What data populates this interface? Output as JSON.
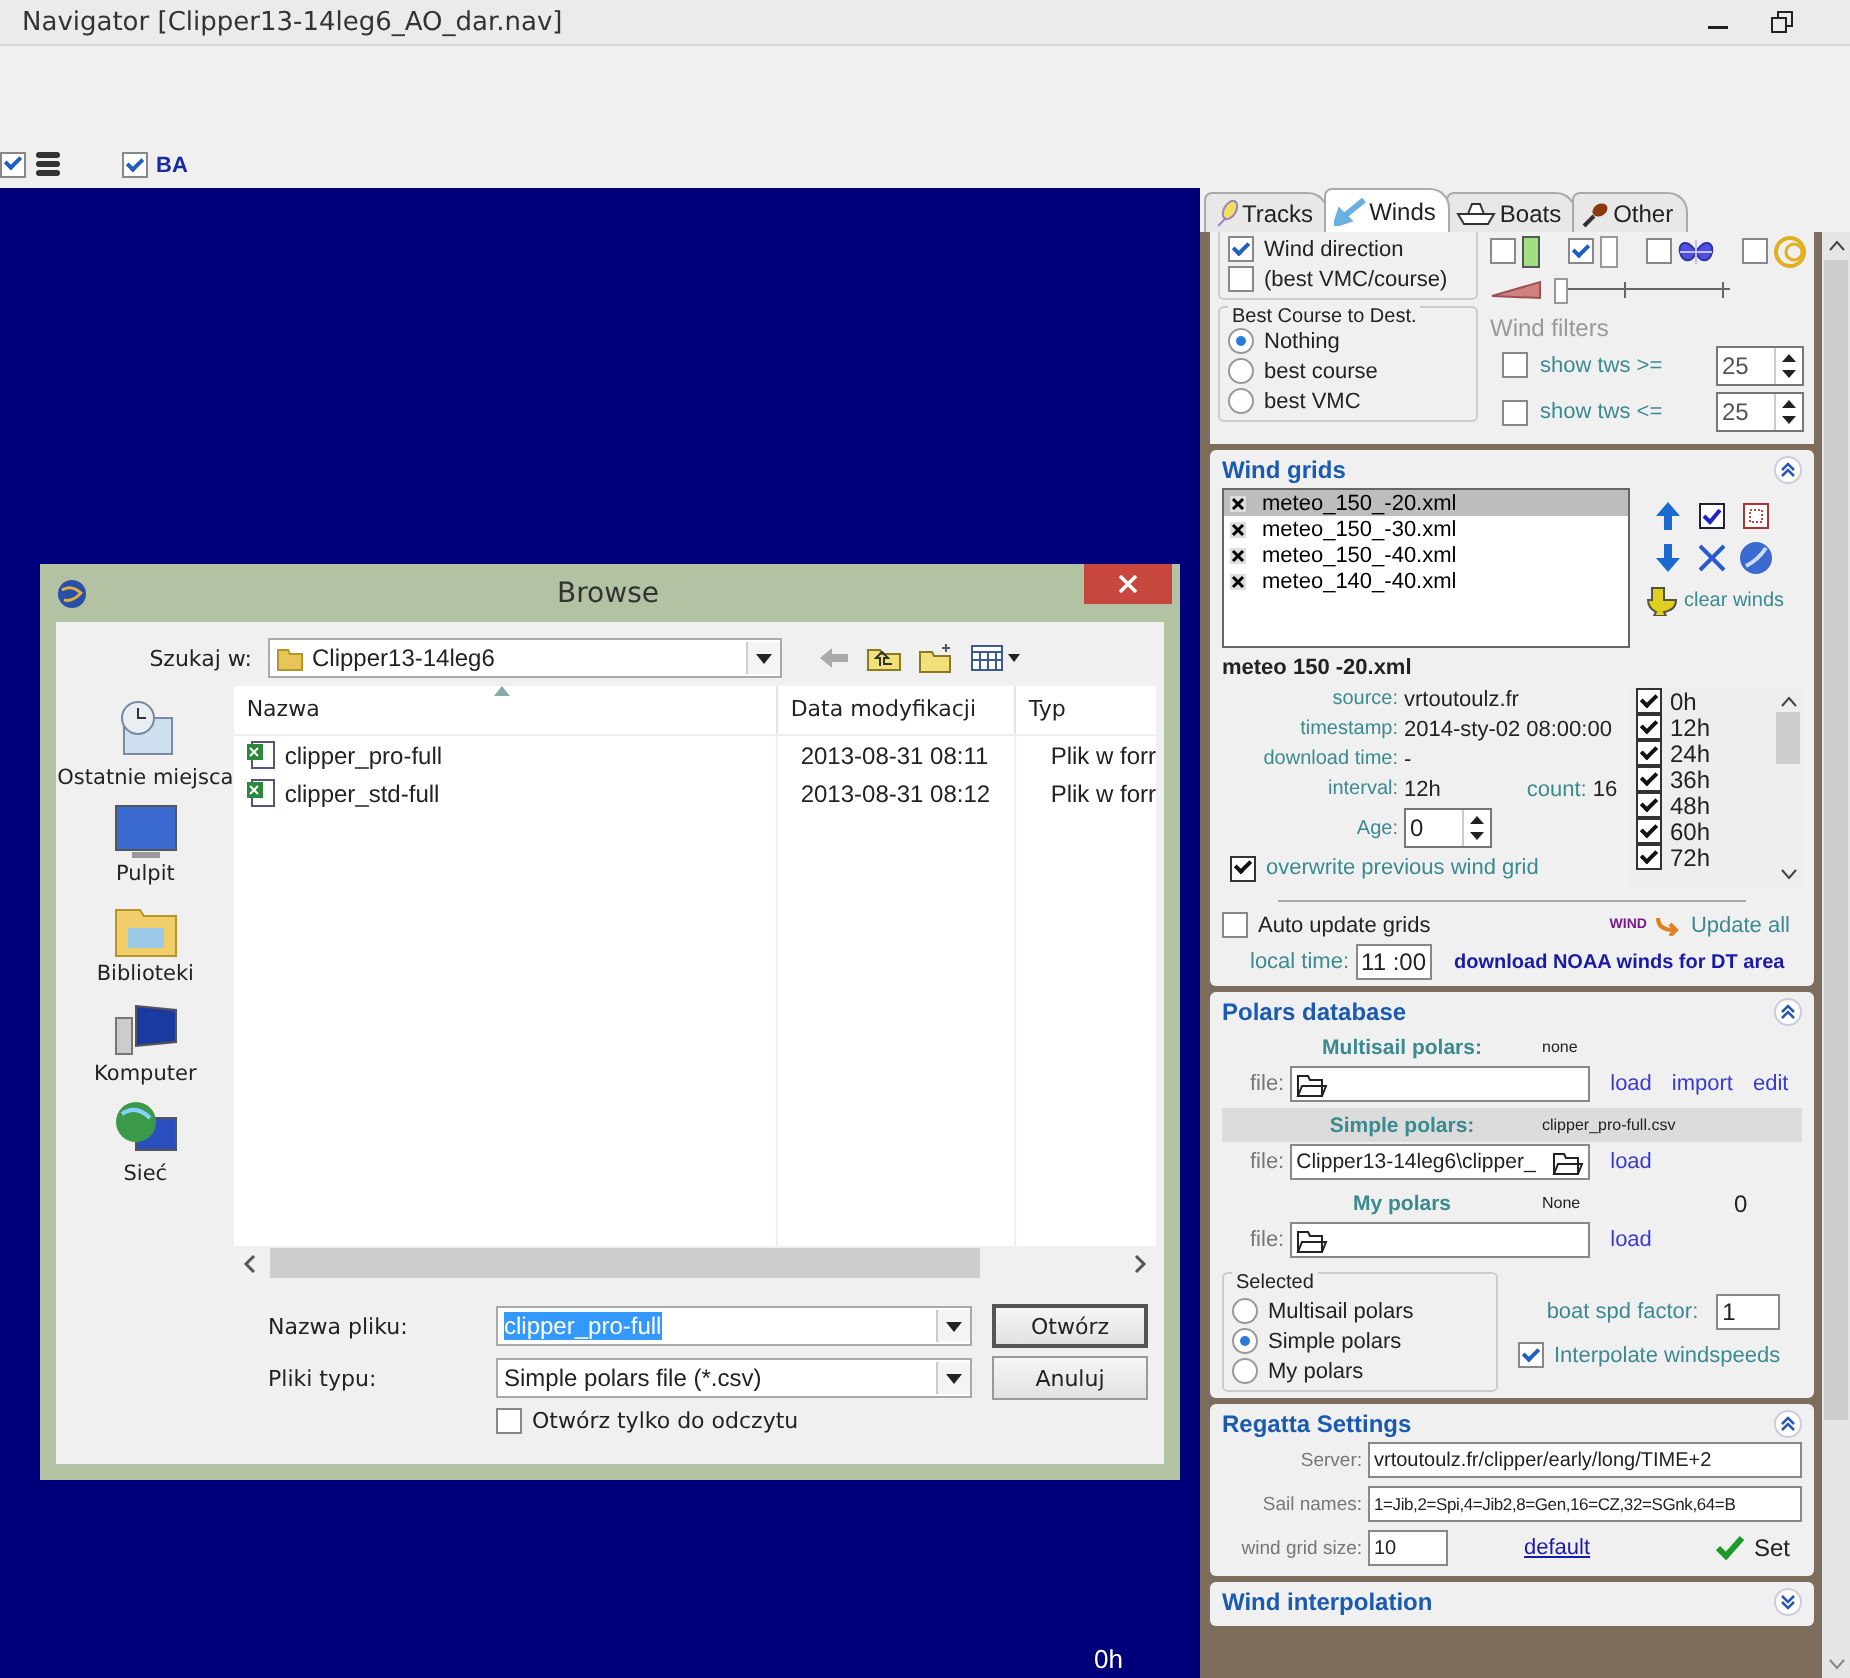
{
  "window": {
    "title": "Navigator [Clipper13-14leg6_AO_dar.nav]"
  },
  "toolbar": {
    "items": [
      {
        "kind": "stack",
        "checked": true
      },
      {
        "kind": "label",
        "label": "BA",
        "checked": true
      }
    ]
  },
  "map": {
    "time_label": "0h"
  },
  "dialog": {
    "title": "Browse",
    "look_in_label": "Szukaj w:",
    "look_in_value": "Clipper13-14leg6",
    "places": [
      {
        "kind": "recent",
        "label": "Ostatnie miejsca"
      },
      {
        "kind": "desktop",
        "label": "Pulpit"
      },
      {
        "kind": "libraries",
        "label": "Biblioteki"
      },
      {
        "kind": "computer",
        "label": "Komputer"
      },
      {
        "kind": "network",
        "label": "Sieć"
      }
    ],
    "columns": [
      "Nazwa",
      "Data modyfikacji",
      "Typ"
    ],
    "files": [
      {
        "name": "clipper_pro-full",
        "modified": "2013-08-31 08:11",
        "type": "Plik w forr"
      },
      {
        "name": "clipper_std-full",
        "modified": "2013-08-31 08:12",
        "type": "Plik w forr"
      }
    ],
    "filename_label": "Nazwa pliku:",
    "filename_value": "clipper_pro-full",
    "filetype_label": "Pliki typu:",
    "filetype_value": "Simple polars file (*.csv)",
    "readonly": {
      "label": "Otwórz tylko do odczytu",
      "checked": false
    },
    "buttons": [
      "Otwórz",
      "Anuluj"
    ]
  },
  "panel": {
    "tabs": [
      {
        "label": "Tracks",
        "selected": false
      },
      {
        "label": "Winds",
        "selected": true
      },
      {
        "label": "Boats",
        "selected": false
      },
      {
        "label": "Other",
        "selected": false
      }
    ],
    "wind_display": {
      "options": [
        {
          "label": "Wind direction",
          "checked": true
        },
        {
          "label": "(best VMC/course)",
          "checked": false
        }
      ],
      "toggles": [
        {
          "kind": "green-bar",
          "checked": false
        },
        {
          "kind": "plain-bar",
          "checked": true
        },
        {
          "kind": "butterfly",
          "checked": false
        },
        {
          "kind": "rings",
          "checked": false
        }
      ],
      "slider": {
        "level": 0
      }
    },
    "best_course": {
      "title": "Best Course to Dest.",
      "options": [
        {
          "label": "Nothing",
          "selected": true
        },
        {
          "label": "best course",
          "selected": false
        },
        {
          "label": "best VMC",
          "selected": false
        }
      ]
    },
    "wind_filters": {
      "title": "Wind filters",
      "rows": [
        {
          "label": "show tws >=",
          "checked": false,
          "value": "25"
        },
        {
          "label": "show tws <=",
          "checked": false,
          "value": "25"
        }
      ]
    },
    "wind_grids": {
      "title": "Wind grids",
      "files": [
        {
          "name": "meteo_150_-20.xml",
          "selected": true
        },
        {
          "name": "meteo_150_-30.xml",
          "selected": false
        },
        {
          "name": "meteo_150_-40.xml",
          "selected": false
        },
        {
          "name": "meteo_140_-40.xml",
          "selected": false
        }
      ],
      "clear_label": "clear winds",
      "current": "meteo  150  -20.xml",
      "details": [
        {
          "label": "source:",
          "value": "vrtoutoulz.fr"
        },
        {
          "label": "timestamp:",
          "value": "2014-sty-02 08:00:00"
        },
        {
          "label": "download time:",
          "value": "-"
        }
      ],
      "interval_label": "interval:",
      "interval": "12h",
      "count_label": "count:",
      "count": "16",
      "age_label": "Age:",
      "age": "0",
      "overwrite": {
        "label": "overwrite previous wind grid",
        "checked": true
      },
      "hours": [
        {
          "label": "0h",
          "checked": true
        },
        {
          "label": "12h",
          "checked": true
        },
        {
          "label": "24h",
          "checked": true
        },
        {
          "label": "36h",
          "checked": true
        },
        {
          "label": "48h",
          "checked": true
        },
        {
          "label": "60h",
          "checked": true
        },
        {
          "label": "72h",
          "checked": true
        }
      ],
      "auto_update": {
        "label": "Auto update grids",
        "checked": false
      },
      "wind_badge": "WIND",
      "update_all": "Update all",
      "local_time_label": "local time:",
      "local_time": "11 :00",
      "download_link": "download NOAA winds for DT area"
    },
    "polars": {
      "title": "Polars database",
      "sources": [
        {
          "title": "Multisail polars:",
          "status": "none",
          "file_label": "file:",
          "links": [
            "load",
            "import",
            "edit"
          ],
          "highlighted": false
        },
        {
          "title": "Simple polars:",
          "status": "clipper_pro-full.csv",
          "file_label": "file:",
          "value": "Clipper13-14leg6\\clipper_",
          "links": [
            "load"
          ],
          "highlighted": true
        },
        {
          "title": "My polars",
          "status": "None",
          "file_label": "file:",
          "links": [
            "load"
          ],
          "highlighted": false,
          "count": "0"
        }
      ],
      "selected_title": "Selected",
      "selected_options": [
        {
          "label": "Multisail polars",
          "selected": false
        },
        {
          "label": "Simple polars",
          "selected": true
        },
        {
          "label": "My polars",
          "selected": false
        }
      ],
      "factor_label": "boat spd factor:",
      "factor": "1",
      "interpolate": {
        "label": "Interpolate windspeeds",
        "checked": true
      }
    },
    "regatta": {
      "title": "Regatta Settings",
      "server_label": "Server:",
      "server": "vrtoutoulz.fr/clipper/early/long/TIME+2",
      "sails_label": "Sail names:",
      "sails": "1=Jib,2=Spi,4=Jib2,8=Gen,16=CZ,32=SGnk,64=B",
      "grid_label": "wind grid size:",
      "grid_size": "10",
      "default_link": "default",
      "set_button": "Set"
    },
    "collapsed": [
      {
        "title": "Wind interpolation"
      }
    ]
  }
}
